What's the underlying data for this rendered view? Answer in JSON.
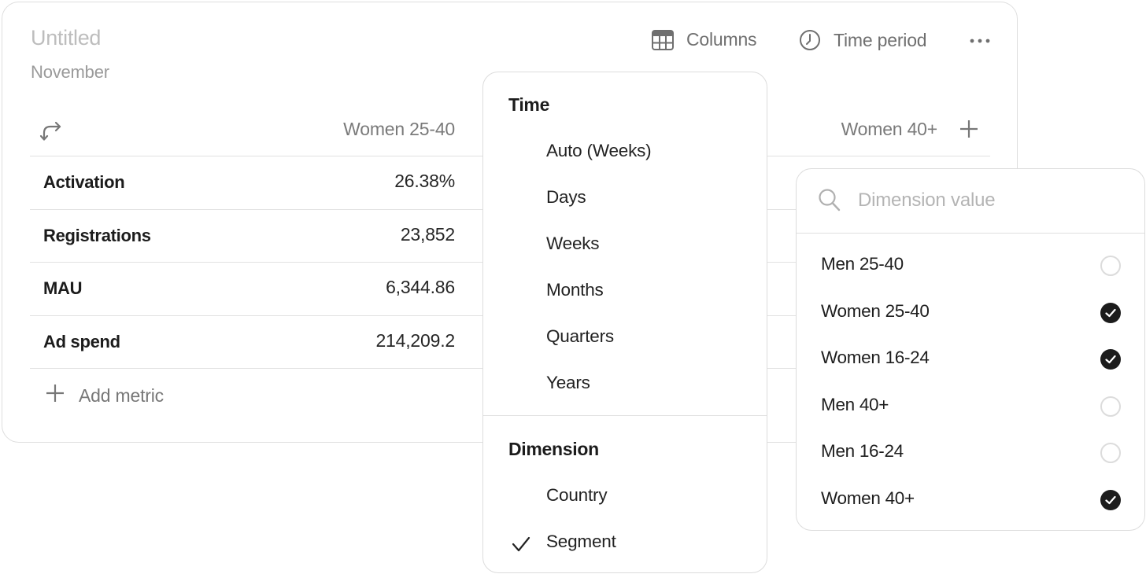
{
  "card": {
    "title": "Untitled",
    "subtitle": "November"
  },
  "toolbar": {
    "columns_label": "Columns",
    "columns_icon": "table-grid-icon",
    "time_period_label": "Time period",
    "time_period_icon": "clock-icon",
    "more_icon": "more-horizontal-icon"
  },
  "table": {
    "swap_icon": "swap-arrows-icon",
    "columns": [
      "Women 25-40",
      "Women 40+"
    ],
    "add_column_icon": "plus-icon",
    "rows": [
      {
        "metric": "Activation",
        "value": "26.38%"
      },
      {
        "metric": "Registrations",
        "value": "23,852"
      },
      {
        "metric": "MAU",
        "value": "6,344.86"
      },
      {
        "metric": "Ad spend",
        "value": "214,209.2"
      }
    ],
    "add_metric_label": "Add metric"
  },
  "time_menu": {
    "time_heading": "Time",
    "time_options": [
      "Auto (Weeks)",
      "Days",
      "Weeks",
      "Months",
      "Quarters",
      "Years"
    ],
    "dimension_heading": "Dimension",
    "dimension_options": [
      {
        "label": "Country",
        "selected": false
      },
      {
        "label": "Segment",
        "selected": true
      }
    ]
  },
  "dimension_menu": {
    "search_placeholder": "Dimension value",
    "search_value": "",
    "options": [
      {
        "label": "Men 25-40",
        "checked": false
      },
      {
        "label": "Women 25-40",
        "checked": true
      },
      {
        "label": "Women 16-24",
        "checked": true
      },
      {
        "label": "Men 40+",
        "checked": false
      },
      {
        "label": "Men 16-24",
        "checked": false
      },
      {
        "label": "Women 40+",
        "checked": true
      }
    ]
  }
}
